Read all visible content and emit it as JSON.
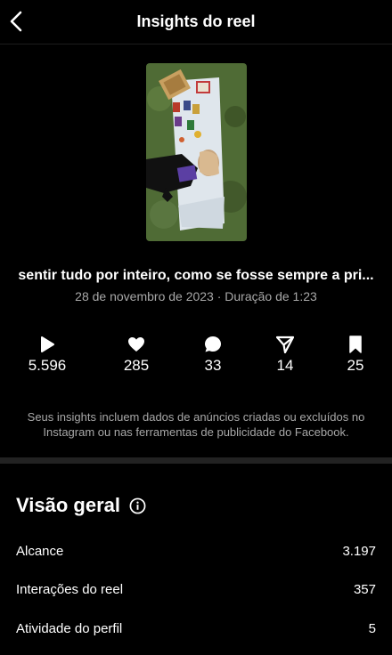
{
  "header": {
    "title": "Insights do reel"
  },
  "reel": {
    "caption": "sentir tudo por inteiro, como se fosse sempre a pri...",
    "meta": "28 de novembro de 2023 · Duração de 1:23"
  },
  "stats": [
    {
      "icon": "play-icon",
      "value": "5.596"
    },
    {
      "icon": "heart-icon",
      "value": "285"
    },
    {
      "icon": "comment-icon",
      "value": "33"
    },
    {
      "icon": "share-icon",
      "value": "14"
    },
    {
      "icon": "bookmark-icon",
      "value": "25"
    }
  ],
  "notice": "Seus insights incluem dados de anúncios criadas ou excluídos no Instagram ou nas ferramentas de publicidade do Facebook.",
  "overview": {
    "title": "Visão geral",
    "rows": [
      {
        "label": "Alcance",
        "value": "3.197"
      },
      {
        "label": "Interações do reel",
        "value": "357"
      },
      {
        "label": "Atividade do perfil",
        "value": "5"
      }
    ]
  }
}
